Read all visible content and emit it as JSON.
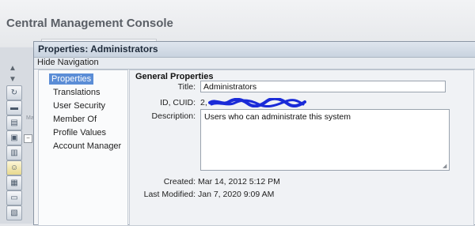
{
  "console": {
    "title": "Central Management Console",
    "rail_tab_label": "Ma"
  },
  "dialog": {
    "title": "Properties: Administrators",
    "hide_navigation_label": "Hide Navigation"
  },
  "nav": {
    "items": [
      {
        "label": "Properties",
        "active": true
      },
      {
        "label": "Translations",
        "active": false
      },
      {
        "label": "User Security",
        "active": false
      },
      {
        "label": "Member Of",
        "active": false
      },
      {
        "label": "Profile Values",
        "active": false
      },
      {
        "label": "Account Manager",
        "active": false
      }
    ]
  },
  "general": {
    "section_title": "General Properties",
    "title_label": "Title:",
    "title_value": "Administrators",
    "cuid_label": "ID, CUID:",
    "cuid_value_visible": "2,",
    "description_label": "Description:",
    "description_value": "Users who can administrate this system",
    "created_label": "Created:",
    "created_value": "Mar 14, 2012 5:12 PM",
    "modified_label": "Last Modified:",
    "modified_value": "Jan 7, 2020 9:09 AM"
  },
  "colors": {
    "nav_active_bg": "#5b8dd6",
    "redaction_scribble": "#1a2bd8"
  }
}
